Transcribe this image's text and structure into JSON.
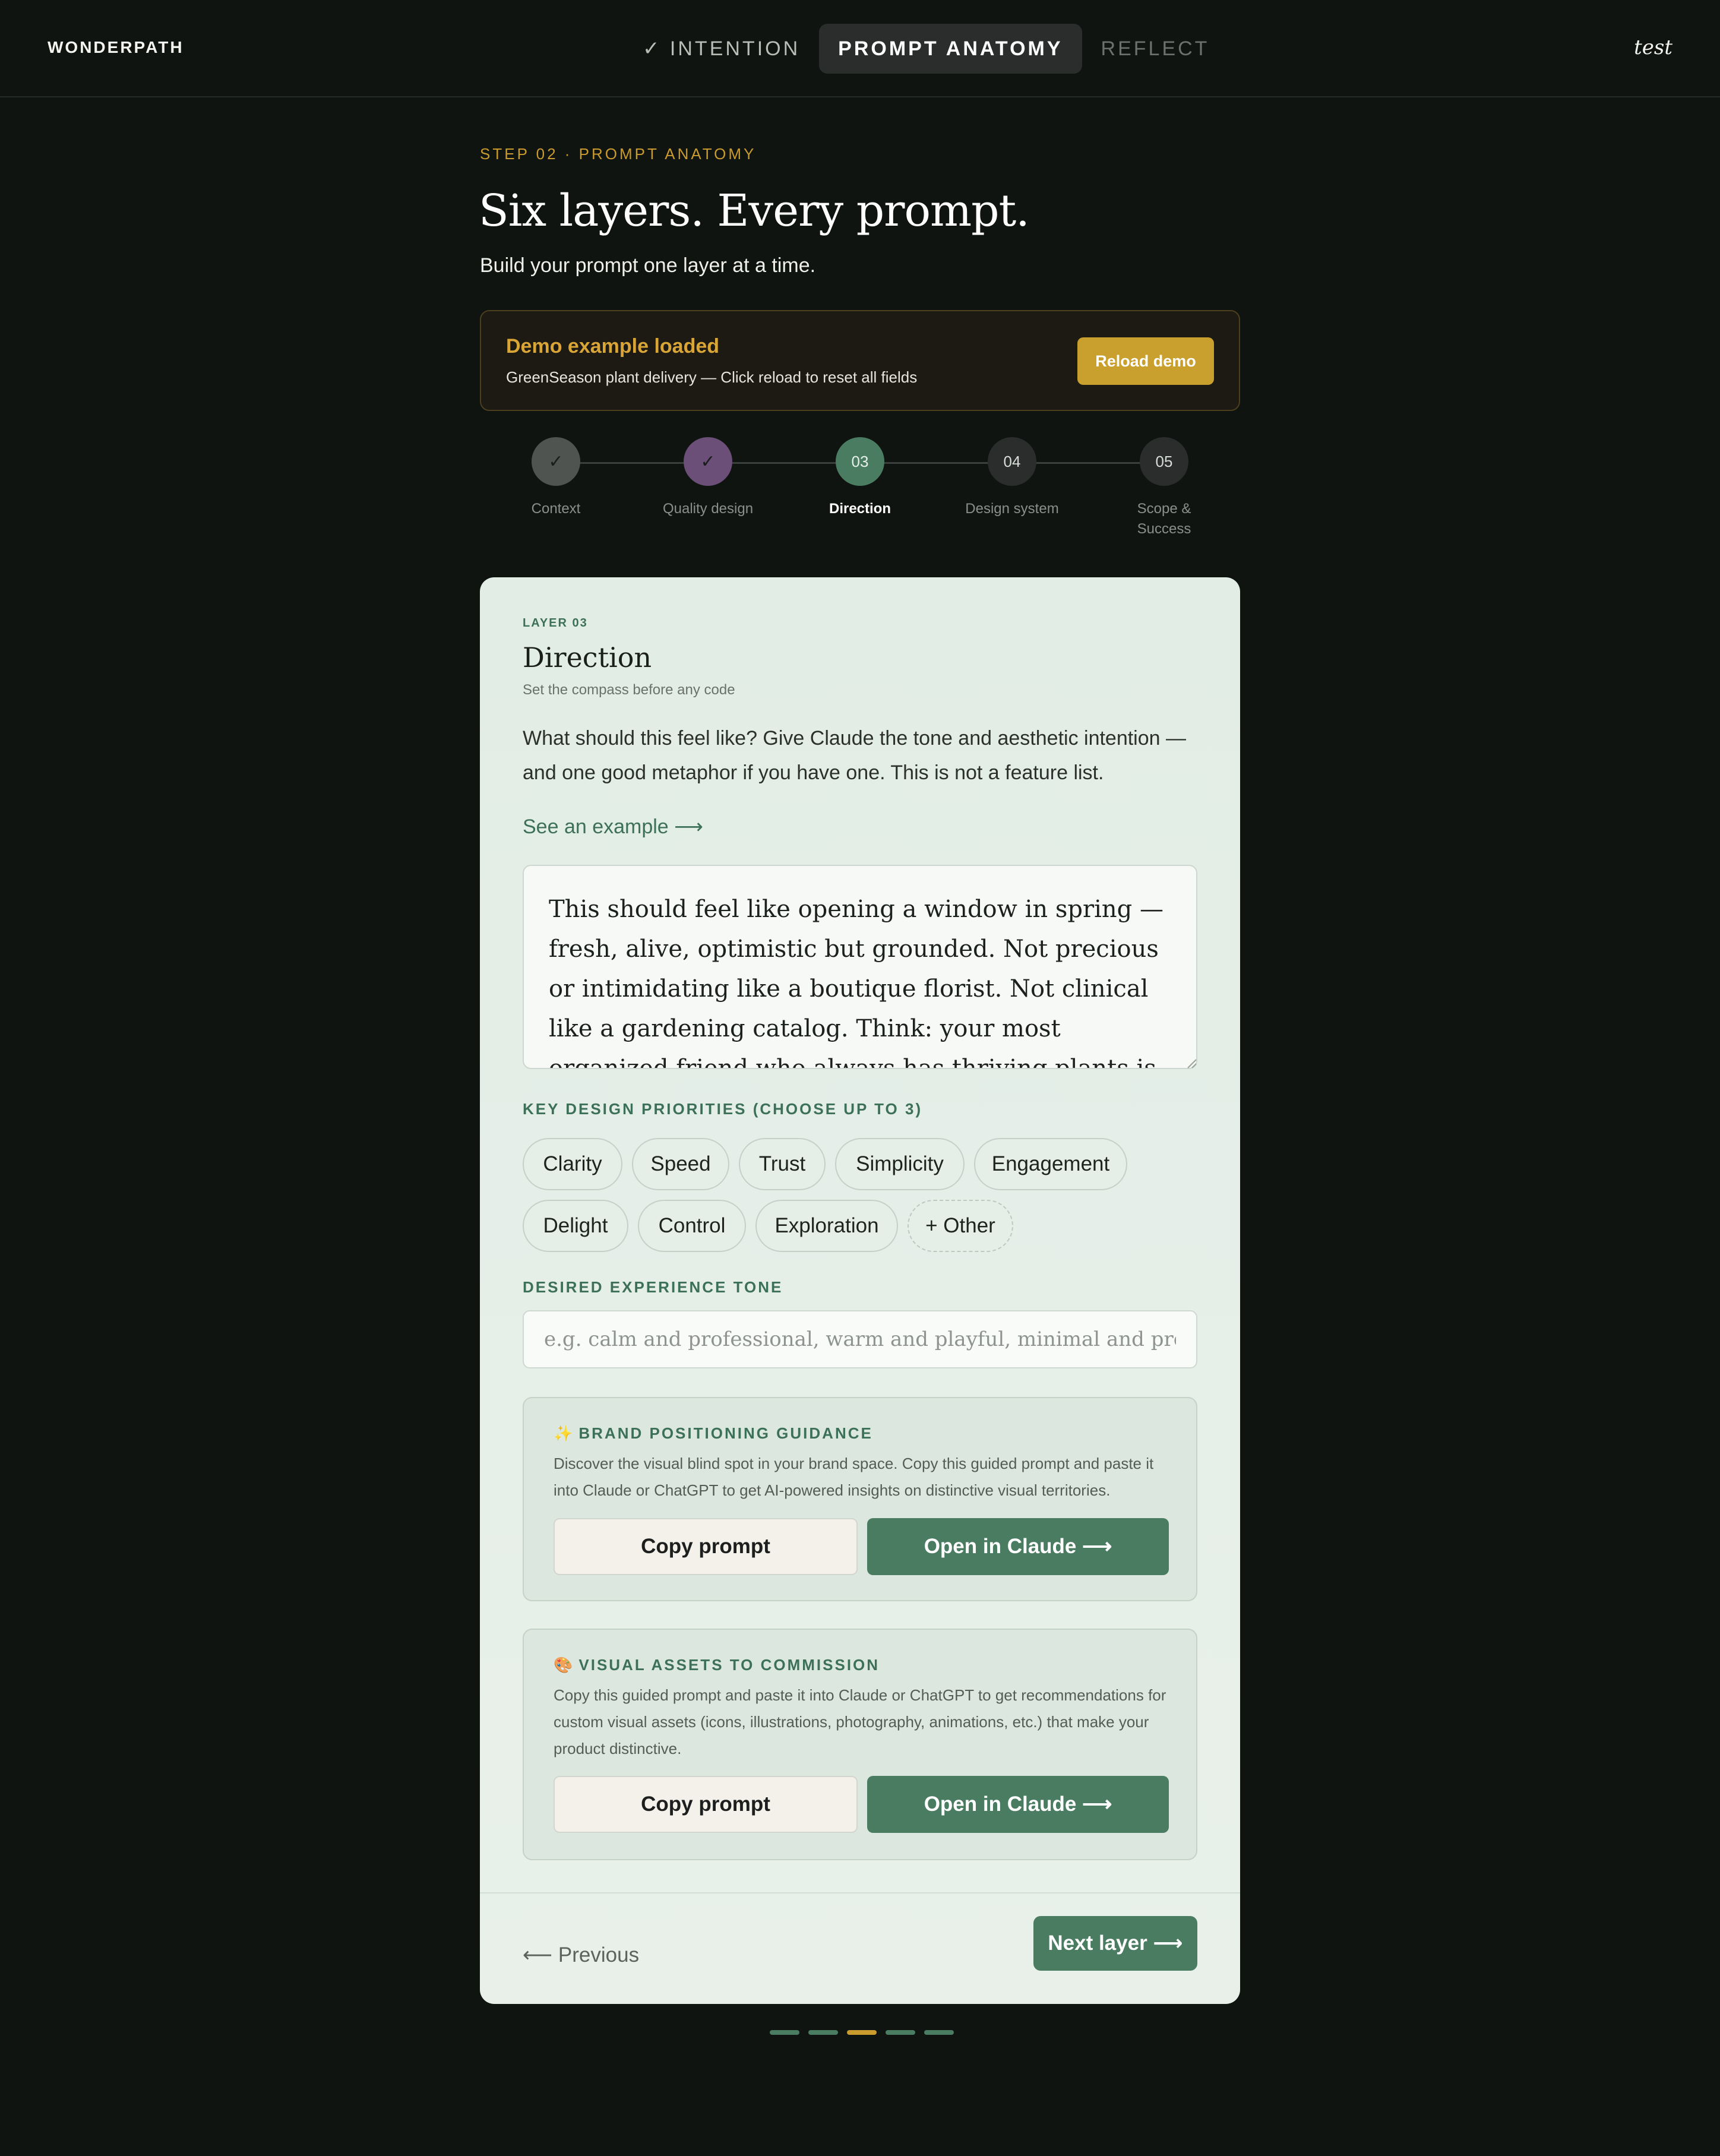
{
  "header": {
    "brand": "WONDERPATH",
    "tabs": [
      {
        "label": "✓ INTENTION",
        "state": "done"
      },
      {
        "label": "PROMPT ANATOMY",
        "state": "active"
      },
      {
        "label": "REFLECT",
        "state": "future"
      }
    ],
    "user": "test"
  },
  "intro": {
    "eyebrow": "STEP 02 · PROMPT ANATOMY",
    "title": "Six layers. Every prompt.",
    "subtitle": "Build your prompt one layer at a time."
  },
  "demo": {
    "title": "Demo example loaded",
    "subtitle": "GreenSeason plant delivery — Click reload to reset all fields",
    "button": "Reload demo"
  },
  "stepper": {
    "steps": [
      {
        "marker": "✓",
        "label": "Context",
        "state": "done",
        "color": "#4f5451"
      },
      {
        "marker": "✓",
        "label": "Quality design",
        "state": "done",
        "color": "#6b4f78"
      },
      {
        "marker": "03",
        "label": "Direction",
        "state": "current",
        "color": "#4a7c62"
      },
      {
        "marker": "04",
        "label": "Design system",
        "state": "upcoming",
        "color": "#2a2d2c"
      },
      {
        "marker": "05",
        "label": "Scope & Success",
        "state": "upcoming",
        "color": "#2a2d2c"
      }
    ]
  },
  "card": {
    "layer_tag": "LAYER 03",
    "title": "Direction",
    "subtitle": "Set the compass before any code",
    "description": "What should this feel like? Give Claude the tone and aesthetic intention — and one good metaphor if you have one. This is not a feature list.",
    "example_link": "See an example ⟶",
    "direction_value": "This should feel like opening a window in spring — fresh, alive, optimistic but grounded. Not precious or intimidating like a boutique florist. Not clinical like a gardening catalog. Think: your most organized friend who always has thriving plants is sharing their secret.",
    "priorities_label": "KEY DESIGN PRIORITIES (CHOOSE UP TO 3)",
    "priorities": [
      "Clarity",
      "Speed",
      "Trust",
      "Simplicity",
      "Engagement",
      "Delight",
      "Control",
      "Exploration",
      "+ Other"
    ],
    "tone_label": "DESIRED EXPERIENCE TONE",
    "tone_placeholder": "e.g. calm and professional, warm and playful, minimal and precise",
    "tone_value": "",
    "brand_guidance": {
      "icon": "✨",
      "title": "BRAND POSITIONING GUIDANCE",
      "description": "Discover the visual blind spot in your brand space. Copy this guided prompt and paste it into Claude or ChatGPT to get AI-powered insights on distinctive visual territories.",
      "copy_button": "Copy prompt",
      "open_button": "Open in Claude ⟶"
    },
    "visual_assets": {
      "icon": "🎨",
      "title": "VISUAL ASSETS TO COMMISSION",
      "description": "Copy this guided prompt and paste it into Claude or ChatGPT to get recommendations for custom visual assets (icons, illustrations, photography, animations, etc.) that make your product distinctive.",
      "copy_button": "Copy prompt",
      "open_button": "Open in Claude ⟶"
    },
    "prev_button": "⟵ Previous",
    "next_button": "Next layer ⟶"
  },
  "progress": {
    "colors": [
      "#4a7c62",
      "#4a7c62",
      "#c99a2e",
      "#4a7c62",
      "#4a7c62"
    ]
  },
  "colors": {
    "background": "#101411",
    "accent_green": "#4a7c62",
    "accent_gold": "#c99a2e"
  }
}
